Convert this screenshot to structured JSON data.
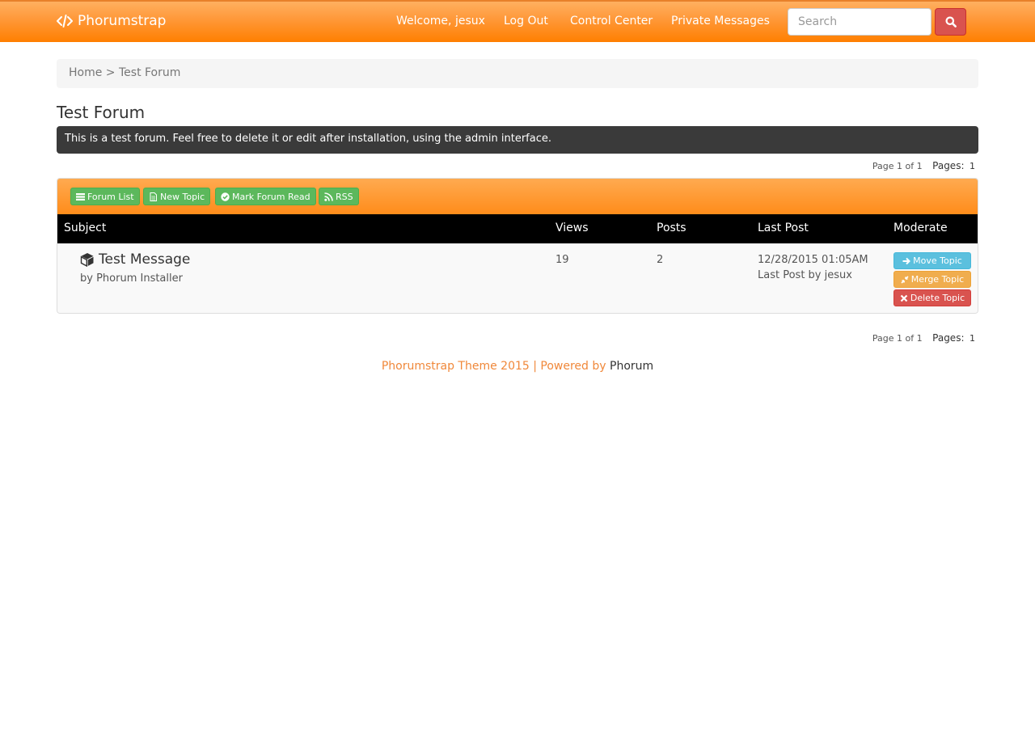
{
  "navbar": {
    "brand": "Phorumstrap",
    "links": [
      "Welcome, jesux",
      "Log Out",
      "Control Center",
      "Private Messages"
    ],
    "search_placeholder": "Search"
  },
  "breadcrumb": {
    "home": "Home",
    "separator": " > ",
    "current": "Test Forum"
  },
  "forum": {
    "title": "Test Forum",
    "description": "This is a test forum. Feel free to delete it or edit after installation, using the admin interface."
  },
  "pager": {
    "page_info": "Page 1 of 1",
    "pages_label": "Pages:",
    "current_page": "1"
  },
  "toolbar": {
    "forum_list": "Forum List",
    "new_topic": "New Topic",
    "mark_read": "Mark Forum Read",
    "rss": "RSS"
  },
  "table": {
    "headers": [
      "Subject",
      "Views",
      "Posts",
      "Last Post",
      "Moderate"
    ],
    "rows": [
      {
        "subject": "Test Message",
        "author": "by Phorum Installer",
        "views": "19",
        "posts": "2",
        "last_post_date": "12/28/2015 01:05AM",
        "last_post_by": "Last Post by jesux"
      }
    ]
  },
  "moderate": {
    "move": "Move Topic",
    "merge": "Merge Topic",
    "delete": "Delete Topic"
  },
  "footer": {
    "theme": "Phorumstrap Theme 2015 | Powered by ",
    "powered": "Phorum"
  },
  "colors": {
    "navbar": "#ff8c1a",
    "success": "#5cb85c",
    "info": "#5bc0de",
    "warning": "#f0ad4e",
    "danger": "#d9534f"
  }
}
